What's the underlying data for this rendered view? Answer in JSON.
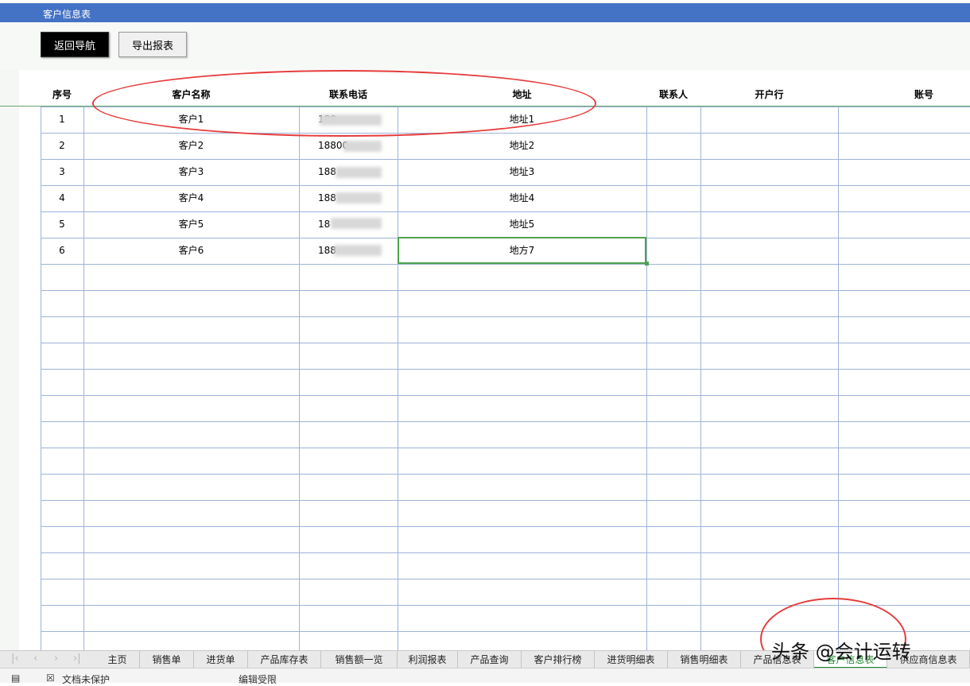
{
  "window": {
    "title": "客户信息表"
  },
  "toolbar": {
    "back_label": "返回导航",
    "export_label": "导出报表"
  },
  "table": {
    "headers": [
      "序号",
      "客户名称",
      "联系电话",
      "地址",
      "联系人",
      "开户行",
      "账号"
    ],
    "rows": [
      [
        "1",
        "客户1",
        "188",
        "地址1"
      ],
      [
        "2",
        "客户2",
        "18800",
        "地址2"
      ],
      [
        "3",
        "客户3",
        "188",
        "地址3"
      ],
      [
        "4",
        "客户4",
        "188",
        "地址4"
      ],
      [
        "5",
        "客户5",
        "18",
        "地址5"
      ],
      [
        "6",
        "客户6",
        "188",
        "地方7"
      ]
    ]
  },
  "tabs": [
    "主页",
    "销售单",
    "进货单",
    "产品库存表",
    "销售额一览",
    "利润报表",
    "产品查询",
    "客户排行榜",
    "进货明细表",
    "销售明细表",
    "产品信息表",
    "客户信息表",
    "供应商信息表"
  ],
  "status": {
    "protect": "文档未保护",
    "edit": "编辑受限"
  },
  "watermark": "头条 @会计运转",
  "colors": {
    "titlebar": "#4472c4",
    "grid": "#9db3d9",
    "selection": "#4ea24e",
    "annotation": "#e63b3b"
  }
}
